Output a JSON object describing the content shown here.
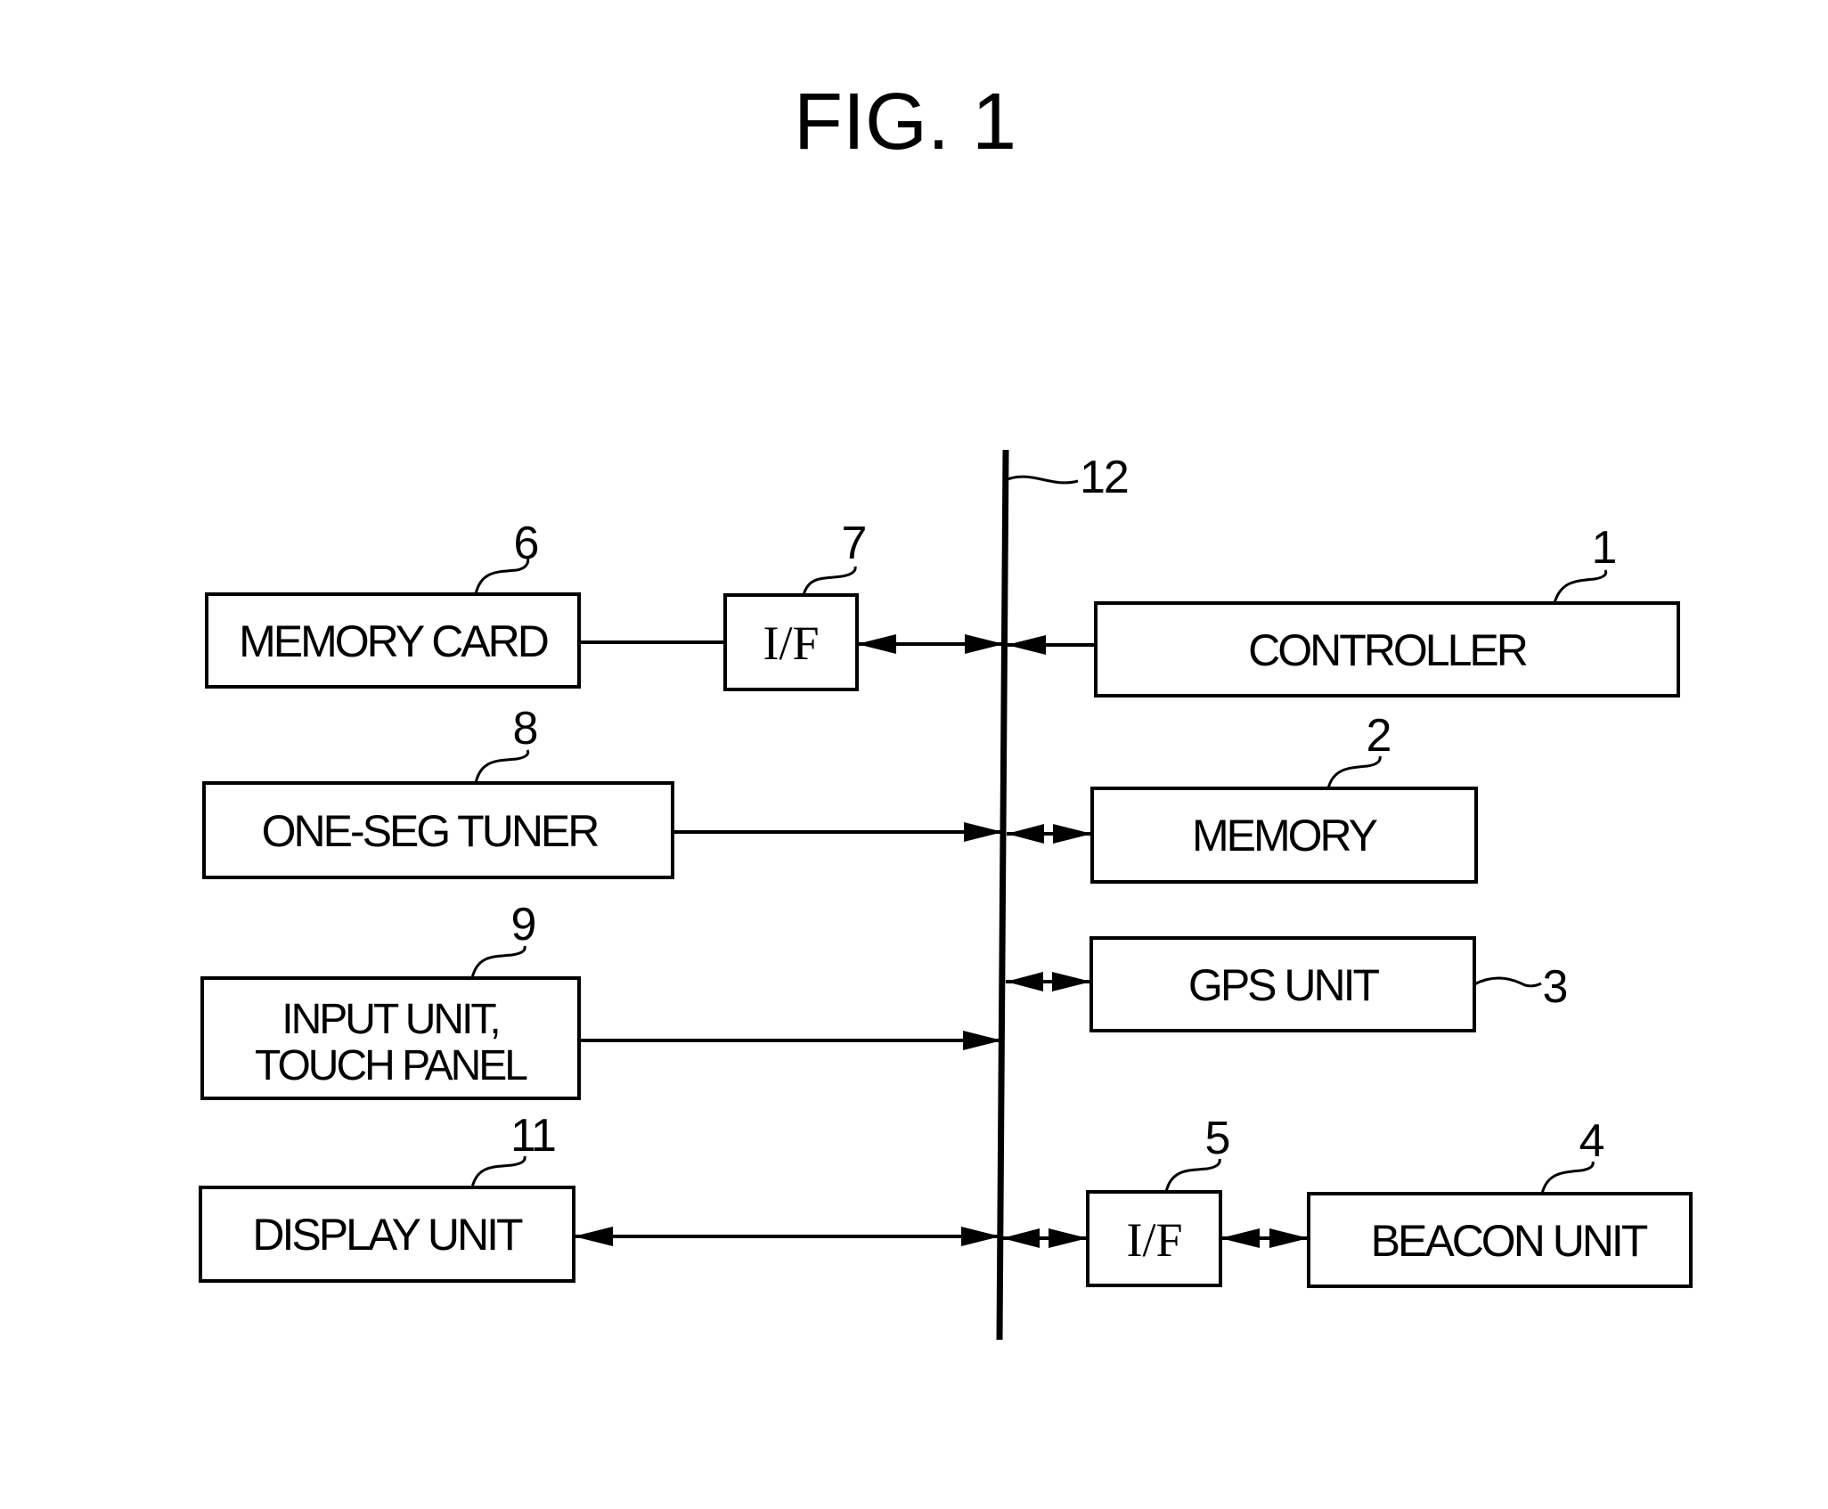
{
  "figure": {
    "title": "FIG. 1",
    "bus": {
      "ref": "12"
    },
    "blocks": {
      "controller": {
        "label": "CONTROLLER",
        "ref": "1"
      },
      "memory": {
        "label": "MEMORY",
        "ref": "2"
      },
      "gps_unit": {
        "label": "GPS UNIT",
        "ref": "3"
      },
      "beacon_unit": {
        "label": "BEACON UNIT",
        "ref": "4"
      },
      "beacon_interface": {
        "label": "I/F",
        "ref": "5"
      },
      "memory_card": {
        "label": "MEMORY CARD",
        "ref": "6"
      },
      "card_interface": {
        "label": "I/F",
        "ref": "7"
      },
      "one_seg_tuner": {
        "label": "ONE-SEG TUNER",
        "ref": "8"
      },
      "input_unit": {
        "label_line1": "INPUT UNIT,",
        "label_line2": "TOUCH PANEL",
        "ref": "9"
      },
      "display_unit": {
        "label": "DISPLAY UNIT",
        "ref": "11"
      }
    },
    "connections": [
      {
        "from": "memory_card",
        "to": "card_interface",
        "direction": "none"
      },
      {
        "from": "card_interface",
        "to": "bus",
        "direction": "bidirectional"
      },
      {
        "from": "controller",
        "to": "bus",
        "direction": "to-bus"
      },
      {
        "from": "one_seg_tuner",
        "to": "bus",
        "direction": "to-bus"
      },
      {
        "from": "memory",
        "to": "bus",
        "direction": "bidirectional"
      },
      {
        "from": "gps_unit",
        "to": "bus",
        "direction": "bidirectional"
      },
      {
        "from": "input_unit",
        "to": "bus",
        "direction": "to-bus"
      },
      {
        "from": "display_unit",
        "to": "bus",
        "direction": "bidirectional"
      },
      {
        "from": "beacon_interface",
        "to": "bus",
        "direction": "bidirectional"
      },
      {
        "from": "beacon_unit",
        "to": "beacon_interface",
        "direction": "bidirectional"
      }
    ]
  }
}
